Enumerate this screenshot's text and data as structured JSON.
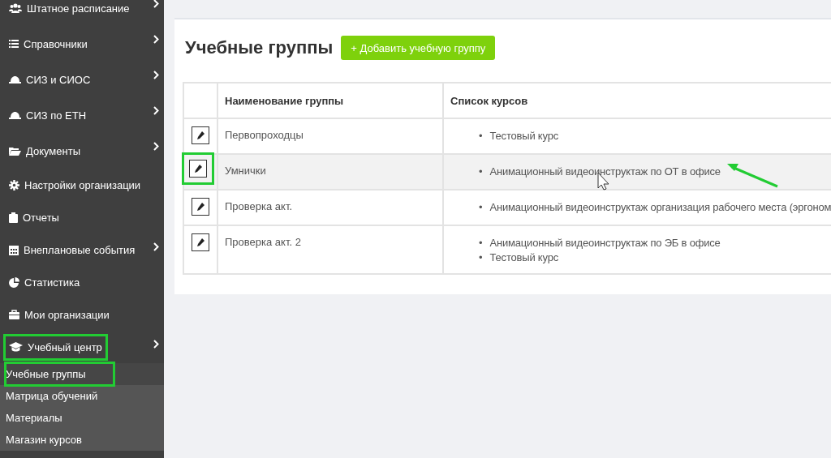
{
  "sidebar": {
    "items": [
      {
        "label": "Штатное расписание",
        "has_submenu": true,
        "marked": false
      },
      {
        "label": "Справочники",
        "has_submenu": true,
        "marked": false
      },
      {
        "label": "СИЗ и СИОС",
        "has_submenu": true,
        "marked": false
      },
      {
        "label": "СИЗ по ЕТН",
        "has_submenu": true,
        "marked": false
      },
      {
        "label": "Документы",
        "has_submenu": true,
        "marked": false
      },
      {
        "label": "Настройки организации",
        "has_submenu": false,
        "marked": false
      },
      {
        "label": "Отчеты",
        "has_submenu": false,
        "marked": false
      },
      {
        "label": "Внеплановые события",
        "has_submenu": true,
        "marked": false
      },
      {
        "label": "Статистика",
        "has_submenu": false,
        "marked": false
      },
      {
        "label": "Мои организации",
        "has_submenu": false,
        "marked": false
      },
      {
        "label": "Учебный центр",
        "has_submenu": true,
        "marked": true,
        "expanded": true,
        "children": [
          {
            "label": "Учебные группы",
            "selected": true,
            "marked": true
          },
          {
            "label": "Матрица обучений",
            "selected": false,
            "marked": false
          },
          {
            "label": "Материалы",
            "selected": false,
            "marked": false
          },
          {
            "label": "Магазин курсов",
            "selected": false,
            "marked": false
          }
        ]
      }
    ]
  },
  "page": {
    "title": "Учебные группы",
    "add_button": "+ Добавить учебную группу"
  },
  "table": {
    "columns": [
      "Наименование группы",
      "Список курсов"
    ],
    "rows": [
      {
        "name": "Первопроходцы",
        "courses": [
          {
            "bullet": "•",
            "text": "Тестовый курс"
          }
        ],
        "hovered": false,
        "marked": false
      },
      {
        "name": "Умнички",
        "courses": [
          {
            "bullet": "•",
            "text": "Анимационный видеоинструктаж по ОТ в офисе"
          }
        ],
        "hovered": true,
        "marked": true
      },
      {
        "name": "Проверка акт.",
        "courses": [
          {
            "bullet": "•",
            "text": "Анимационный видеоинструктаж организация рабочего места (эргоном"
          }
        ],
        "hovered": false,
        "marked": false
      },
      {
        "name": "Проверка акт. 2",
        "courses": [
          {
            "bullet": "•",
            "text": "Анимационный видеоинструктаж по ЭБ в офисе"
          },
          {
            "bullet": "•",
            "text": "Тестовый курс"
          }
        ],
        "hovered": false,
        "marked": false
      }
    ]
  }
}
